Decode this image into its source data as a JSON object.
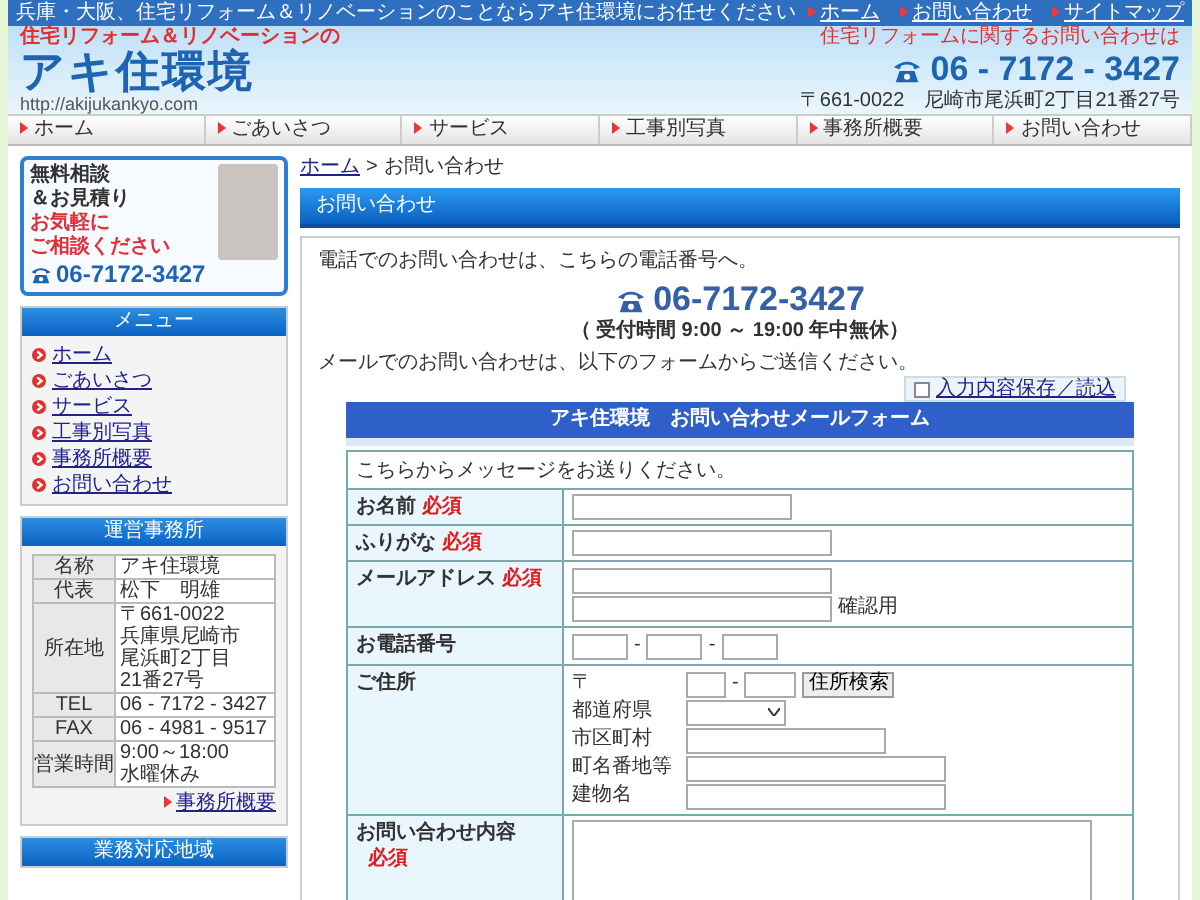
{
  "top_bar": {
    "text": "兵庫・大阪、住宅リフォーム＆リノベーションのことならアキ住環境にお任せください",
    "links": [
      "ホーム",
      "お問い合わせ",
      "サイトマップ"
    ]
  },
  "header": {
    "tagline": "住宅リフォーム＆リノベーションの",
    "logo": "アキ住環境",
    "url": "http://akijukankyo.com",
    "contact_label": "住宅リフォームに関するお問い合わせは",
    "phone": "06 - 7172 - 3427",
    "address": "〒661-0022　尼崎市尾浜町2丁目21番27号"
  },
  "nav": [
    "ホーム",
    "ごあいさつ",
    "サービス",
    "工事別写真",
    "事務所概要",
    "お問い合わせ"
  ],
  "banner": {
    "lines": [
      "無料相談",
      "＆お見積り"
    ],
    "highlight": [
      "お気軽に",
      "ご相談ください"
    ],
    "phone": "06-7172-3427"
  },
  "menu": {
    "title": "メニュー",
    "items": [
      "ホーム",
      "ごあいさつ",
      "サービス",
      "工事別写真",
      "事務所概要",
      "お問い合わせ"
    ]
  },
  "office": {
    "title": "運営事務所",
    "rows": [
      {
        "label": "名称",
        "value": [
          "アキ住環境"
        ]
      },
      {
        "label": "代表",
        "value": [
          "松下　明雄"
        ]
      },
      {
        "label": "所在地",
        "value": [
          "〒661-0022",
          "兵庫県尼崎市",
          "尾浜町2丁目",
          "21番27号"
        ]
      },
      {
        "label": "TEL",
        "value": [
          "06 - 7172 - 3427"
        ]
      },
      {
        "label": "FAX",
        "value": [
          "06 - 4981 - 9517"
        ]
      },
      {
        "label": "営業時間",
        "value": [
          "9:00～18:00",
          "水曜休み"
        ]
      }
    ],
    "link": "事務所概要"
  },
  "area": {
    "title": "業務対応地域"
  },
  "breadcrumb": {
    "home": "ホーム",
    "separator": ">",
    "current": "お問い合わせ"
  },
  "page_title": "お問い合わせ",
  "phone_section": {
    "intro": "電話でのお問い合わせは、こちらの電話番号へ。",
    "phone": "06-7172-3427",
    "hours": "（ 受付時間  9:00 ～ 19:00  年中無休）"
  },
  "mail_intro": "メールでのお問い合わせは、以下のフォームからご送信ください。",
  "save_option": {
    "label": "入力内容保存／読込",
    "checked": false
  },
  "form": {
    "title": "アキ住環境　お問い合わせメールフォーム",
    "intro": "こちらからメッセージをお送りください。",
    "rows": [
      {
        "kind": "text",
        "label": "お名前",
        "required": "必須"
      },
      {
        "kind": "text",
        "label": "ふりがな",
        "required": "必須"
      },
      {
        "kind": "email",
        "label": "メールアドレス",
        "required": "必須",
        "confirm_label": "確認用"
      },
      {
        "kind": "phone",
        "label": "お電話番号",
        "separators": [
          "-",
          "-"
        ]
      },
      {
        "kind": "address",
        "label": "ご住所",
        "postal_mark": "〒",
        "postal_separator": "-",
        "search_button": "住所検索",
        "fields": [
          {
            "kind": "select",
            "label": "都道府県"
          },
          {
            "kind": "input",
            "label": "市区町村"
          },
          {
            "kind": "input",
            "label": "町名番地等"
          },
          {
            "kind": "input",
            "label": "建物名"
          }
        ]
      },
      {
        "kind": "textarea",
        "label": "お問い合わせ内容",
        "required": "必須"
      }
    ]
  }
}
